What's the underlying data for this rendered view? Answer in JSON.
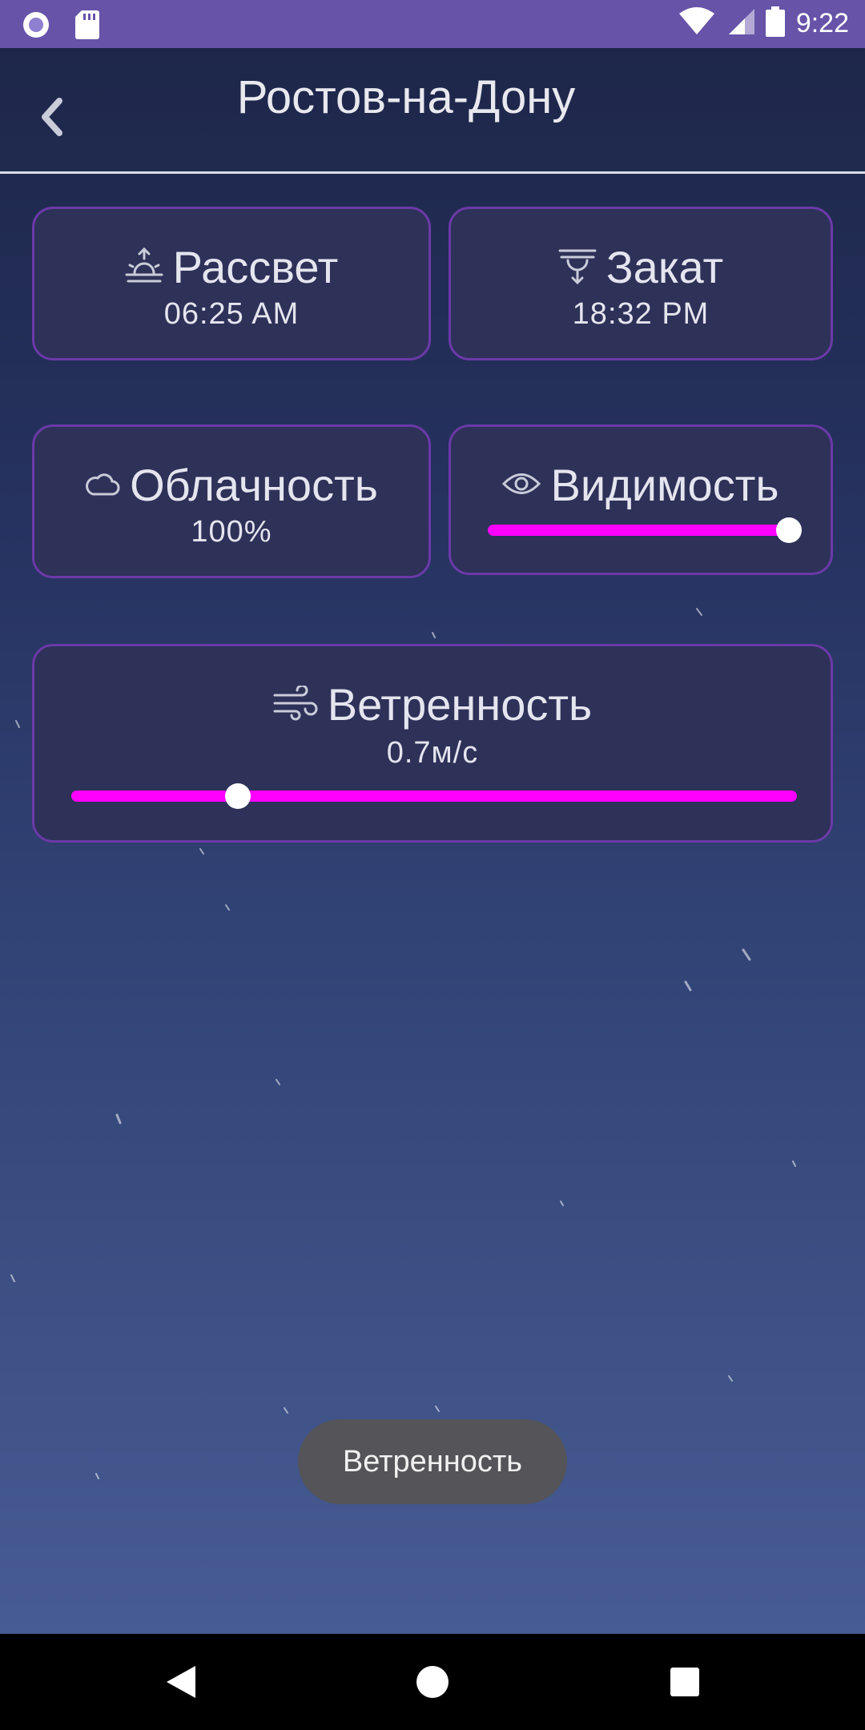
{
  "status_bar": {
    "time": "9:22",
    "left_icons": [
      "notification-circle-icon",
      "sd-card-icon"
    ],
    "right_icons": [
      "wifi-icon",
      "signal-icon",
      "battery-icon"
    ],
    "color": "#6753a8"
  },
  "header": {
    "title": "Ростов-на-Дону",
    "back_icon": "chevron-left-icon"
  },
  "cards": {
    "sunrise": {
      "title": "Рассвет",
      "value": "06:25 AM",
      "icon": "sunrise-icon"
    },
    "sunset": {
      "title": "Закат",
      "value": "18:32 PM",
      "icon": "sunset-icon"
    },
    "cloudiness": {
      "title": "Облачность",
      "value": "100%",
      "icon": "cloud-icon"
    },
    "visibility": {
      "title": "Видимость",
      "icon": "eye-icon",
      "level": 1.0
    },
    "wind": {
      "title": "Ветренность",
      "value": "0.7м/с",
      "icon": "wind-icon",
      "level": 0.23
    }
  },
  "toast": {
    "text": "Ветренность"
  },
  "nav_bar": {
    "icons": [
      "back-triangle-icon",
      "home-circle-icon",
      "recents-square-icon"
    ]
  },
  "colors": {
    "card_bg": "#2e3158",
    "card_border": "#6b3aa8",
    "slider": "#ff00ff",
    "toast_bg": "#545459"
  }
}
